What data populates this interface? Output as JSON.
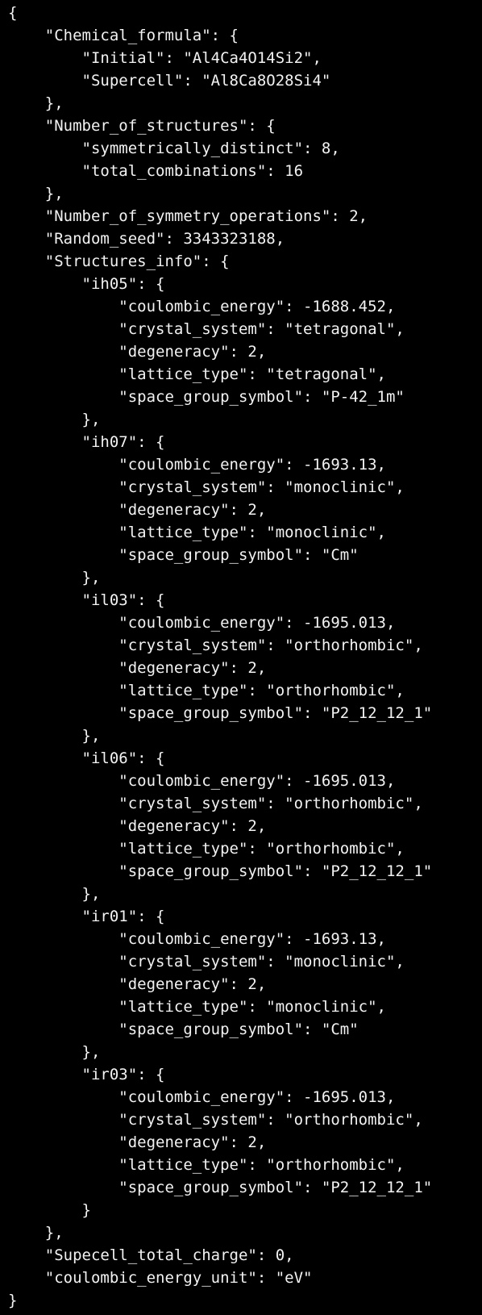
{
  "window": {
    "colors": {
      "background": "#000000",
      "text": "#f2f2f2"
    }
  },
  "document": {
    "lines": [
      "{",
      "    \"Chemical_formula\": {",
      "        \"Initial\": \"Al4Ca4O14Si2\",",
      "        \"Supercell\": \"Al8Ca8O28Si4\"",
      "    },",
      "    \"Number_of_structures\": {",
      "        \"symmetrically_distinct\": 8,",
      "        \"total_combinations\": 16",
      "    },",
      "    \"Number_of_symmetry_operations\": 2,",
      "    \"Random_seed\": 3343323188,",
      "    \"Structures_info\": {",
      "        \"ih05\": {",
      "            \"coulombic_energy\": -1688.452,",
      "            \"crystal_system\": \"tetragonal\",",
      "            \"degeneracy\": 2,",
      "            \"lattice_type\": \"tetragonal\",",
      "            \"space_group_symbol\": \"P-42_1m\"",
      "        },",
      "        \"ih07\": {",
      "            \"coulombic_energy\": -1693.13,",
      "            \"crystal_system\": \"monoclinic\",",
      "            \"degeneracy\": 2,",
      "            \"lattice_type\": \"monoclinic\",",
      "            \"space_group_symbol\": \"Cm\"",
      "        },",
      "        \"il03\": {",
      "            \"coulombic_energy\": -1695.013,",
      "            \"crystal_system\": \"orthorhombic\",",
      "            \"degeneracy\": 2,",
      "            \"lattice_type\": \"orthorhombic\",",
      "            \"space_group_symbol\": \"P2_12_12_1\"",
      "        },",
      "        \"il06\": {",
      "            \"coulombic_energy\": -1695.013,",
      "            \"crystal_system\": \"orthorhombic\",",
      "            \"degeneracy\": 2,",
      "            \"lattice_type\": \"orthorhombic\",",
      "            \"space_group_symbol\": \"P2_12_12_1\"",
      "        },",
      "        \"ir01\": {",
      "            \"coulombic_energy\": -1693.13,",
      "            \"crystal_system\": \"monoclinic\",",
      "            \"degeneracy\": 2,",
      "            \"lattice_type\": \"monoclinic\",",
      "            \"space_group_symbol\": \"Cm\"",
      "        },",
      "        \"ir03\": {",
      "            \"coulombic_energy\": -1695.013,",
      "            \"crystal_system\": \"orthorhombic\",",
      "            \"degeneracy\": 2,",
      "            \"lattice_type\": \"orthorhombic\",",
      "            \"space_group_symbol\": \"P2_12_12_1\"",
      "        }",
      "    },",
      "    \"Supecell_total_charge\": 0,",
      "    \"coulombic_energy_unit\": \"eV\"",
      "}"
    ]
  }
}
